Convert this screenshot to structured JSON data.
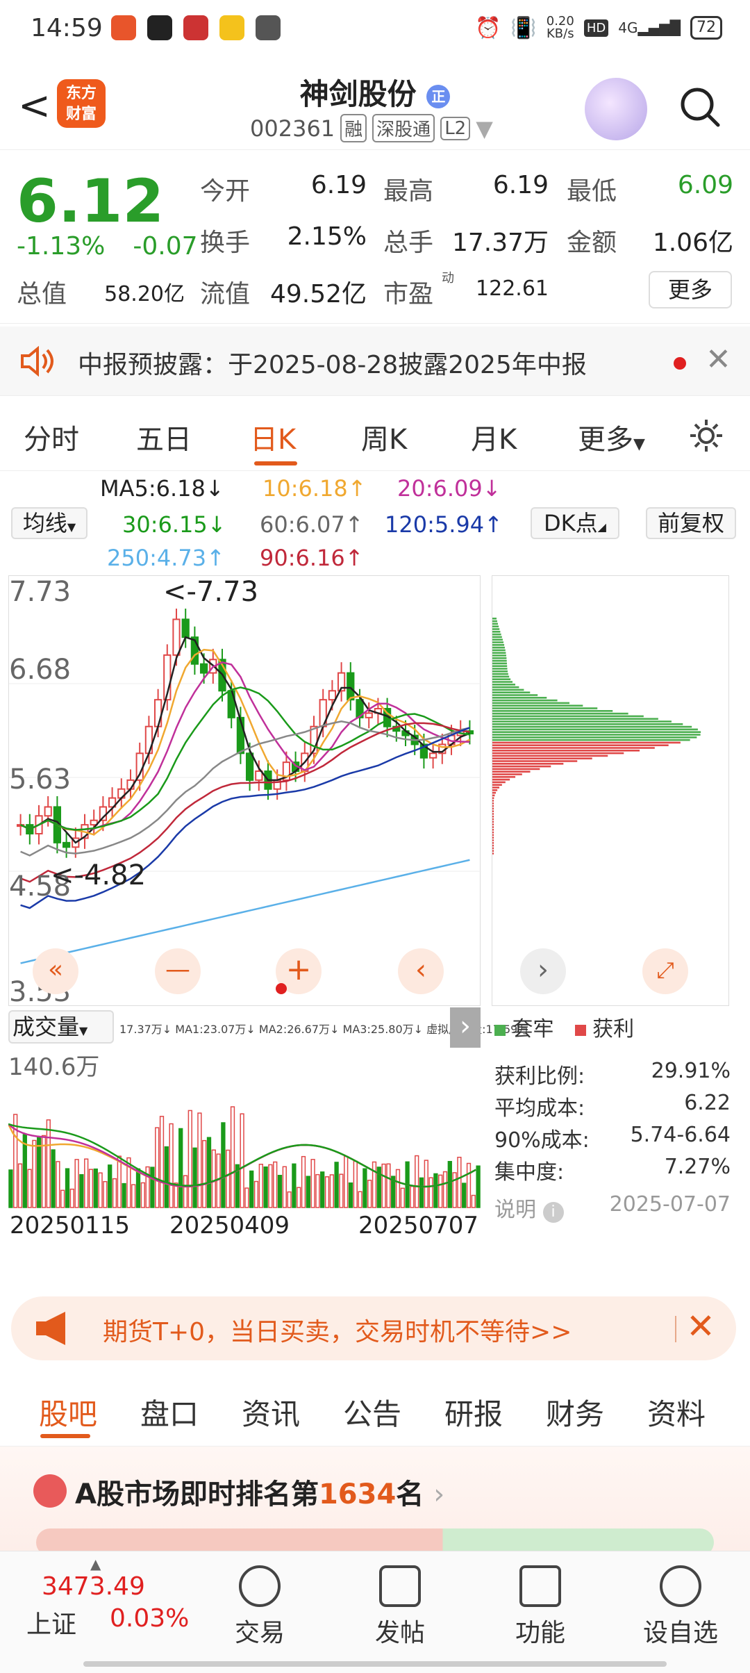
{
  "status": {
    "time": "14:59",
    "net_speed_top": "0.20",
    "net_speed_unit": "KB/s",
    "net_type": "4G",
    "battery": "72"
  },
  "header": {
    "title": "神剑股份",
    "title_badge": "正",
    "code": "002361",
    "tags": [
      "融",
      "深股通",
      "L2"
    ],
    "logo_line1": "东方",
    "logo_line2": "财富"
  },
  "quote": {
    "price": "6.12",
    "change_pct": "-1.13%",
    "change": "-0.07",
    "open_label": "今开",
    "open": "6.19",
    "high_label": "最高",
    "high": "6.19",
    "low_label": "最低",
    "low": "6.09",
    "turnover_label": "换手",
    "turnover": "2.15%",
    "volume_label": "总手",
    "volume": "17.37万",
    "amount_label": "金额",
    "amount": "1.06亿",
    "mcap_label": "总值",
    "mcap": "58.20亿",
    "float_label": "流值",
    "float": "49.52亿",
    "pe_label": "市盈",
    "pe_sup": "动",
    "pe": "122.61",
    "more": "更多"
  },
  "notice": {
    "text": "中报预披露：于2025-08-28披露2025年中报"
  },
  "tabs": [
    "分时",
    "五日",
    "日K",
    "周K",
    "月K",
    "更多"
  ],
  "ma": {
    "selector": "均线",
    "ma5": "MA5:6.18↓",
    "ma10": "10:6.18↑",
    "ma20": "20:6.09↓",
    "ma30": "30:6.15↓",
    "ma60": "60:6.07↑",
    "ma120": "120:5.94↑",
    "ma250": "250:4.73↑",
    "ma90": "90:6.16↑",
    "dk": "DK点",
    "adj": "前复权"
  },
  "chart_data": {
    "type": "candlestick",
    "y_ticks": [
      "7.73",
      "6.68",
      "5.63",
      "4.58",
      "3.53"
    ],
    "ylim": [
      3.53,
      7.73
    ],
    "max_label": "<-7.73",
    "min_label": "<-4.82",
    "close_series": [
      5.1,
      5.0,
      5.2,
      5.3,
      4.9,
      4.85,
      4.95,
      5.1,
      5.15,
      5.3,
      5.4,
      5.5,
      5.6,
      5.9,
      6.2,
      6.5,
      7.0,
      7.4,
      7.2,
      6.9,
      6.8,
      6.95,
      6.6,
      6.3,
      5.9,
      5.6,
      5.7,
      5.5,
      5.6,
      5.8,
      5.7,
      5.9,
      6.2,
      6.5,
      6.6,
      6.8,
      6.5,
      6.3,
      6.35,
      6.4,
      6.2,
      6.15,
      6.1,
      6.0,
      5.85,
      5.9,
      6.0,
      6.1,
      6.15,
      6.12
    ],
    "profile_legend": [
      "套牢",
      "获利"
    ],
    "x_labels": [
      "20250115",
      "20250409",
      "20250707"
    ]
  },
  "volume": {
    "selector": "成交量",
    "header": "17.37万↓ MA1:23.07万↓ MA2:26.67万↓ MA3:25.80万↓ 虚拟成交量:17.59万",
    "max_label": "140.6万"
  },
  "chip": {
    "legend_trapped": "套牢",
    "legend_profit": "获利",
    "rows": [
      {
        "label": "获利比例:",
        "value": "29.91%"
      },
      {
        "label": "平均成本:",
        "value": "6.22"
      },
      {
        "label": "90%成本:",
        "value": "5.74-6.64"
      },
      {
        "label": "集中度:",
        "value": "7.27%"
      }
    ],
    "note_label": "说明",
    "date": "2025-07-07"
  },
  "promo": {
    "text": "期货T+0，当日买卖，交易时机不等待>>"
  },
  "nav2": [
    "股吧",
    "盘口",
    "资讯",
    "公告",
    "研报",
    "财务",
    "资料"
  ],
  "rank": {
    "prefix": "A股市场即时排名第",
    "num": "1634",
    "suffix": "名"
  },
  "bottom": {
    "index_value": "3473.49",
    "index_name": "上证",
    "index_pct": "0.03%",
    "items": [
      "交易",
      "发帖",
      "功能",
      "设自选"
    ]
  }
}
